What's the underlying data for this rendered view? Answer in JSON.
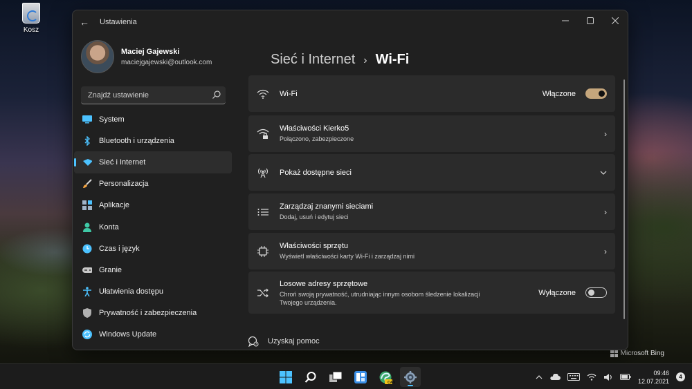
{
  "desktop": {
    "recycle_bin_label": "Kosz",
    "watermark": "Microsoft Bing"
  },
  "window": {
    "title": "Ustawienia"
  },
  "profile": {
    "name": "Maciej Gajewski",
    "email": "maciejgajewski@outlook.com"
  },
  "search": {
    "placeholder": "Znajdź ustawienie"
  },
  "sidebar": {
    "items": [
      {
        "label": "System",
        "icon": "monitor-icon",
        "color": "#4cc2ff"
      },
      {
        "label": "Bluetooth i urządzenia",
        "icon": "bluetooth-icon",
        "color": "#4cc2ff"
      },
      {
        "label": "Sieć i Internet",
        "icon": "network-icon",
        "color": "#4cc2ff",
        "active": true
      },
      {
        "label": "Personalizacja",
        "icon": "brush-icon",
        "color": "#f4a340"
      },
      {
        "label": "Aplikacje",
        "icon": "apps-icon",
        "color": "#a0b4c8"
      },
      {
        "label": "Konta",
        "icon": "person-icon",
        "color": "#3fc9a6"
      },
      {
        "label": "Czas i język",
        "icon": "globe-clock-icon",
        "color": "#4cc2ff"
      },
      {
        "label": "Granie",
        "icon": "gamepad-icon",
        "color": "#c8c8c8"
      },
      {
        "label": "Ułatwienia dostępu",
        "icon": "accessibility-icon",
        "color": "#4cc2ff"
      },
      {
        "label": "Prywatność i zabezpieczenia",
        "icon": "shield-icon",
        "color": "#b0b0b0"
      },
      {
        "label": "Windows Update",
        "icon": "update-icon",
        "color": "#4cc2ff"
      }
    ]
  },
  "breadcrumb": {
    "parent": "Sieć i Internet",
    "separator": "›",
    "current": "Wi-Fi"
  },
  "cards": {
    "wifi": {
      "title": "Wi-Fi",
      "status": "Włączone",
      "toggle": "on"
    },
    "properties": {
      "title": "Właściwości Kierko5",
      "subtitle": "Połączono, zabezpieczone"
    },
    "available": {
      "title": "Pokaż dostępne sieci"
    },
    "manage": {
      "title": "Zarządzaj znanymi sieciami",
      "subtitle": "Dodaj, usuń i edytuj sieci"
    },
    "hardware": {
      "title": "Właściwości sprzętu",
      "subtitle": "Wyświetl właściwości karty Wi-Fi i zarządzaj nimi"
    },
    "random": {
      "title": "Losowe adresy sprzętowe",
      "subtitle_line1": "Chroń swoją prywatność, utrudniając innym osobom śledzenie lokalizacji",
      "subtitle_line2": "Twojego urządzenia.",
      "status": "Wyłączone",
      "toggle": "off"
    }
  },
  "help": {
    "label": "Uzyskaj pomoc"
  },
  "taskbar": {
    "apps": [
      "start-icon",
      "search-icon",
      "task-view-icon",
      "widgets-icon",
      "edge-canary-icon",
      "settings-icon"
    ],
    "edge_badge": "CAN",
    "time": "09:46",
    "date": "12.07.2021",
    "notification_count": "4"
  }
}
